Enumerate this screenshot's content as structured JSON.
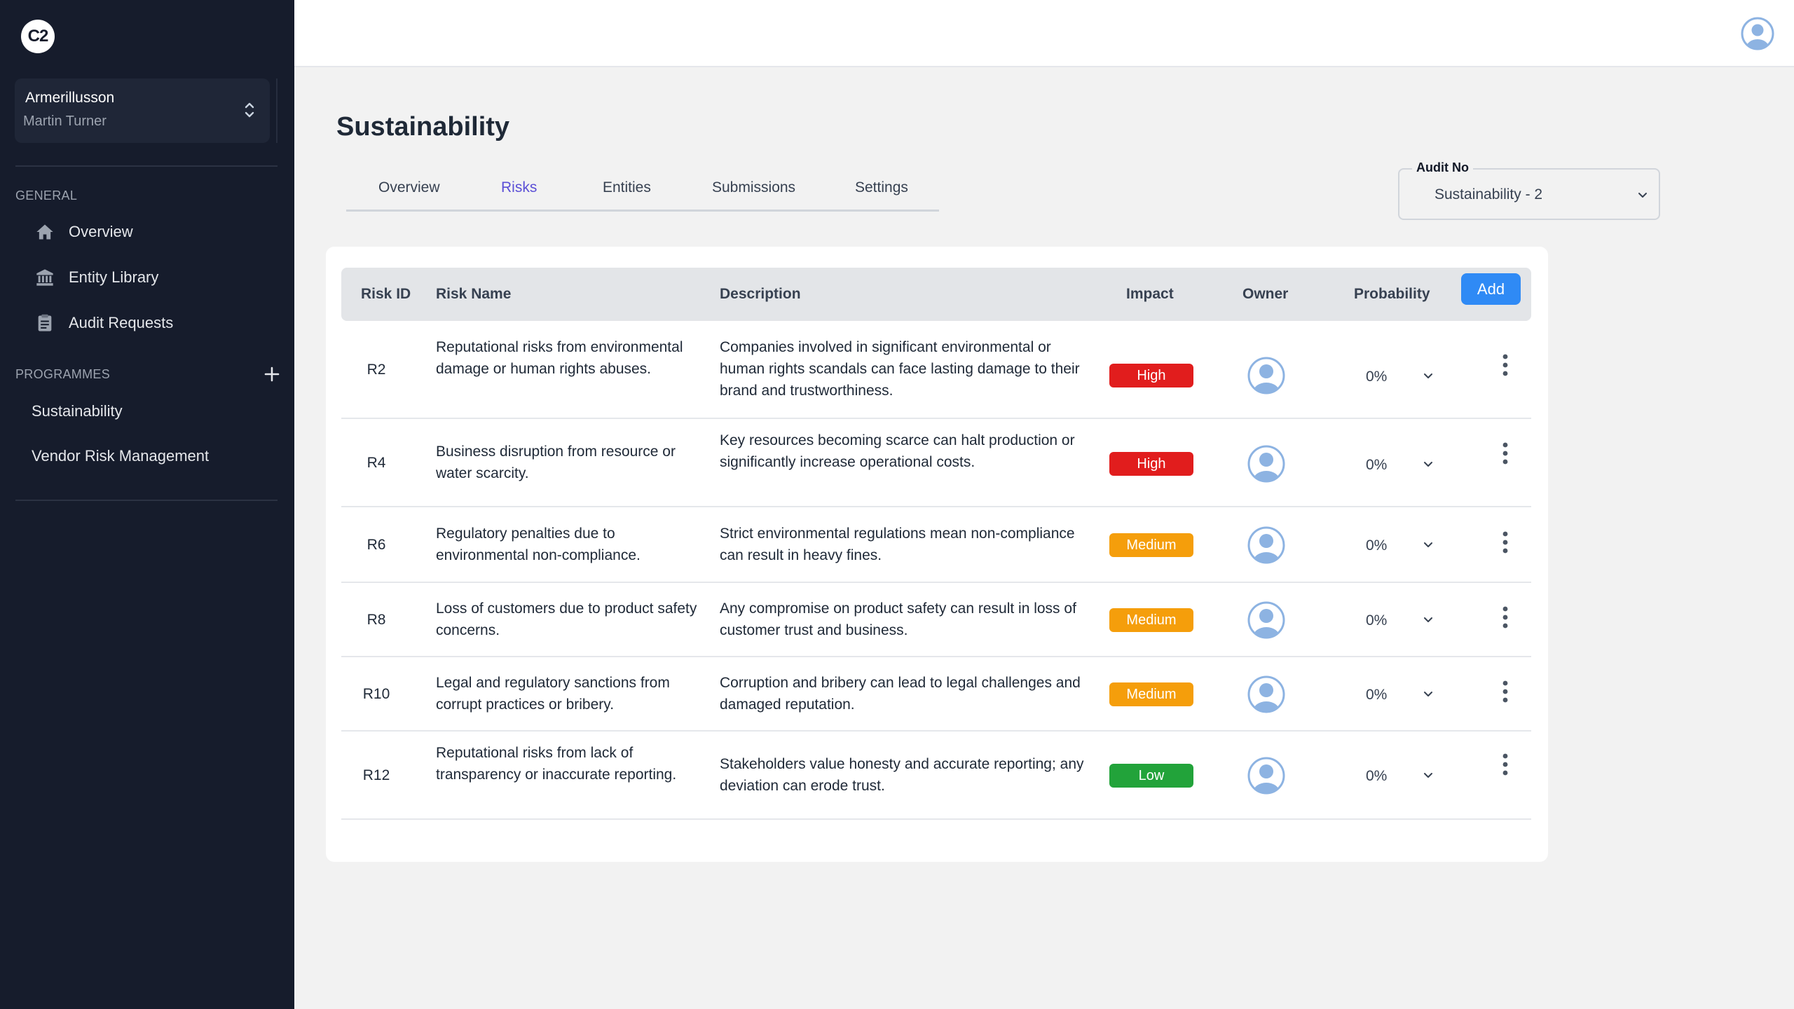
{
  "app": {
    "logo": "C2"
  },
  "org_switcher": {
    "org": "Armerillusson",
    "user": "Martin Turner",
    "icon": "chevrons-up-down-icon"
  },
  "sidebar": {
    "general_label": "GENERAL",
    "general_items": [
      {
        "label": "Overview",
        "icon": "home-icon"
      },
      {
        "label": "Entity Library",
        "icon": "bank-icon"
      },
      {
        "label": "Audit Requests",
        "icon": "clipboard-icon"
      }
    ],
    "programmes_label": "PROGRAMMES",
    "programmes": [
      {
        "label": "Sustainability"
      },
      {
        "label": "Vendor Risk Management"
      }
    ]
  },
  "page": {
    "title": "Sustainability"
  },
  "tabs": [
    {
      "label": "Overview",
      "active": false
    },
    {
      "label": "Risks",
      "active": true
    },
    {
      "label": "Entities",
      "active": false
    },
    {
      "label": "Submissions",
      "active": false
    },
    {
      "label": "Settings",
      "active": false
    }
  ],
  "audit_select": {
    "label": "Audit No",
    "value": "Sustainability - 2"
  },
  "table": {
    "headers": {
      "risk_id": "Risk ID",
      "risk_name": "Risk Name",
      "description": "Description",
      "impact": "Impact",
      "owner": "Owner",
      "probability": "Probability"
    },
    "add_label": "Add",
    "rows": [
      {
        "id": "R2",
        "name": "Reputational risks from environmental damage or human rights abuses.",
        "description": "Companies involved in significant environmental or human rights scandals can face lasting damage to their brand and trustworthiness.",
        "impact": "High",
        "probability": "0%"
      },
      {
        "id": "R4",
        "name": "Business disruption from resource or water scarcity.",
        "description": "Key resources becoming scarce can halt production or significantly increase operational costs.",
        "impact": "High",
        "probability": "0%"
      },
      {
        "id": "R6",
        "name": "Regulatory penalties due to environmental non-compliance.",
        "description": "Strict environmental regulations mean non-compliance can result in heavy fines.",
        "impact": "Medium",
        "probability": "0%"
      },
      {
        "id": "R8",
        "name": "Loss of customers due to product safety concerns.",
        "description": "Any compromise on product safety can result in loss of customer trust and business.",
        "impact": "Medium",
        "probability": "0%"
      },
      {
        "id": "R10",
        "name": "Legal and regulatory sanctions from corrupt practices or bribery.",
        "description": "Corruption and bribery can lead to legal challenges and damaged reputation.",
        "impact": "Medium",
        "probability": "0%"
      },
      {
        "id": "R12",
        "name": "Reputational risks from lack of transparency or inaccurate reporting.",
        "description": "Stakeholders value honesty and accurate reporting; any deviation can erode trust.",
        "impact": "Low",
        "probability": "0%"
      }
    ]
  },
  "colors": {
    "sidebar_bg": "#161c2c",
    "accent": "#5b4fd6",
    "add_button": "#2f8af5",
    "high": "#e11d1d",
    "medium": "#f59e0b",
    "low": "#22a33a"
  }
}
